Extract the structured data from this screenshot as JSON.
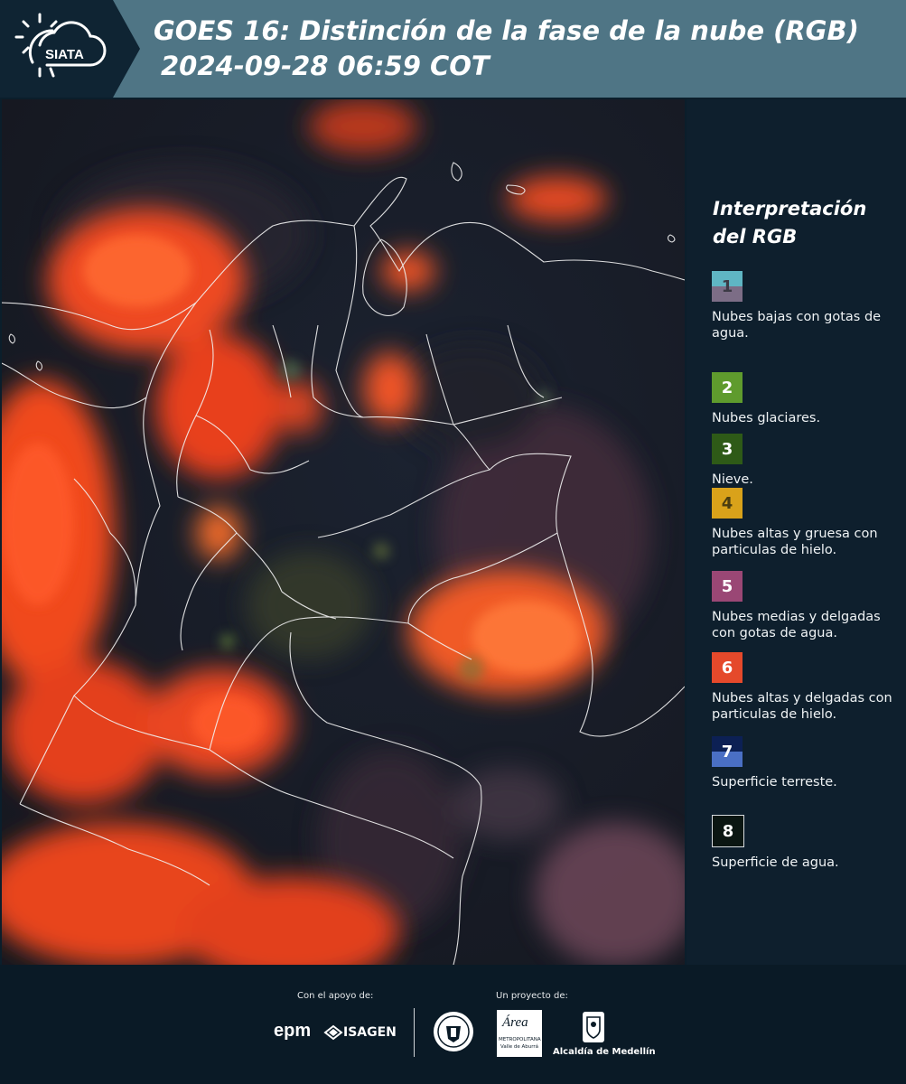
{
  "header": {
    "logo_text": "SIATA",
    "title": "GOES 16: Distinción de la fase de la nube (RGB)",
    "datetime": "2024-09-28 06:59 COT"
  },
  "legend": {
    "title": "Interpretación del RGB",
    "items": [
      {
        "num": "1",
        "label": "Nubes bajas con gotas de agua.",
        "color_top": "#5fb6c4",
        "color_bottom": "#7c6d86",
        "num_color": "#3c3a45"
      },
      {
        "num": "2",
        "label": "Nubes glaciares.",
        "color_top": "#5f9b2d",
        "color_bottom": "#5f9b2d",
        "num_color": "#ffffff"
      },
      {
        "num": "3",
        "label": "Nieve.",
        "color_top": "#2e5a17",
        "color_bottom": "#2e5a17",
        "num_color": "#ffffff"
      },
      {
        "num": "4",
        "label": "Nubes altas y gruesa con particulas de hielo.",
        "color_top": "#d9a21a",
        "color_bottom": "#d9a21a",
        "num_color": "#4a3d10"
      },
      {
        "num": "5",
        "label": "Nubes medias y delgadas con gotas de agua.",
        "color_top": "#9a4775",
        "color_bottom": "#9a4775",
        "num_color": "#ffffff"
      },
      {
        "num": "6",
        "label": "Nubes altas y delgadas con particulas de hielo.",
        "color_top": "#e5492b",
        "color_bottom": "#e5492b",
        "num_color": "#ffffff"
      },
      {
        "num": "7",
        "label": "Superficie terreste.",
        "color_top": "#0c2054",
        "color_bottom": "#4a6fc4",
        "num_color": "#ffffff"
      },
      {
        "num": "8",
        "label": "Superficie de agua.",
        "color_top": "#0b1612",
        "color_bottom": "#0b1612",
        "num_color": "#ffffff"
      }
    ]
  },
  "footer": {
    "support_caption": "Con el apoyo de:",
    "project_caption": "Un proyecto de:",
    "sponsor_1": "epm",
    "sponsor_2": "ISAGEN",
    "area_word": "Área",
    "area_line1": "METROPOLITANA",
    "area_line2": "Valle de Aburrá",
    "alcaldia": "Alcaldía de Medellín"
  }
}
